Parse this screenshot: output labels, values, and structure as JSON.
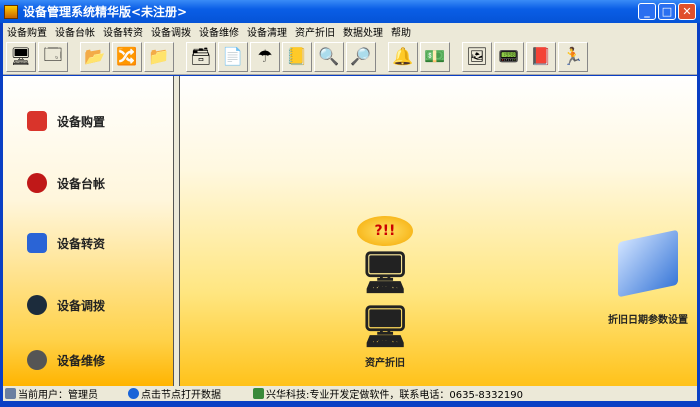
{
  "window": {
    "title": "设备管理系统精华版<未注册>"
  },
  "menu": [
    "设备购置",
    "设备台帐",
    "设备转资",
    "设备调拨",
    "设备维修",
    "设备清理",
    "资产折旧",
    "数据处理",
    "帮助"
  ],
  "toolbar": [
    {
      "icon": "monitor-icon",
      "glyph": "🖥"
    },
    {
      "icon": "screen-icon",
      "glyph": "🗔"
    },
    {
      "icon": "folder-open-icon",
      "glyph": "📂"
    },
    {
      "icon": "transfer-icon",
      "glyph": "🔀"
    },
    {
      "icon": "folder-icon",
      "glyph": "📁"
    },
    {
      "icon": "archive-icon",
      "glyph": "🗃"
    },
    {
      "icon": "documents-icon",
      "glyph": "📄"
    },
    {
      "icon": "umbrella-icon",
      "glyph": "☂"
    },
    {
      "icon": "notebook-icon",
      "glyph": "📒"
    },
    {
      "icon": "search-document-icon",
      "glyph": "🔍"
    },
    {
      "icon": "magnifier-icon",
      "glyph": "🔎"
    },
    {
      "icon": "bell-icon",
      "glyph": "🔔"
    },
    {
      "icon": "money-icon",
      "glyph": "💵"
    },
    {
      "icon": "picture-icon",
      "glyph": "🖼"
    },
    {
      "icon": "pda-icon",
      "glyph": "📟"
    },
    {
      "icon": "help-book-icon",
      "glyph": "📕"
    },
    {
      "icon": "exit-icon",
      "glyph": "🏃"
    }
  ],
  "nav": [
    {
      "label": "设备购置",
      "color": "#d9342b"
    },
    {
      "label": "设备台帐",
      "color": "#c01818"
    },
    {
      "label": "设备转资",
      "color": "#2a64d6"
    },
    {
      "label": "设备调拨",
      "color": "#1c2c3c"
    },
    {
      "label": "设备维修",
      "color": "#555555"
    }
  ],
  "main": {
    "node1": {
      "label": "资产折旧",
      "bubble": "?!!"
    },
    "node2": {
      "label": "折旧日期参数设置"
    }
  },
  "status": {
    "user": "当前用户：管理员",
    "hint": "点击节点打开数据",
    "company": "兴华科技:专业开发定做软件，联系电话：0635-8332190"
  }
}
